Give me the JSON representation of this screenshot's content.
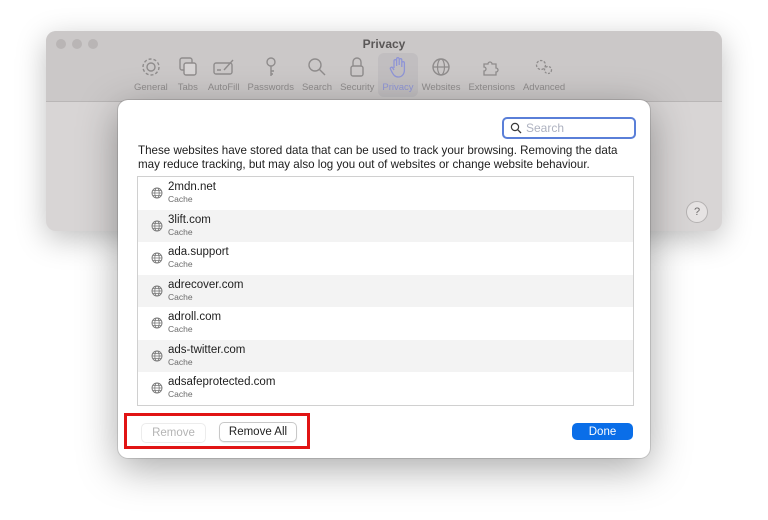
{
  "prefs": {
    "title": "Privacy",
    "toolbar": [
      {
        "label": "General",
        "icon": "gear-icon"
      },
      {
        "label": "Tabs",
        "icon": "tabs-icon"
      },
      {
        "label": "AutoFill",
        "icon": "autofill-icon"
      },
      {
        "label": "Passwords",
        "icon": "key-icon"
      },
      {
        "label": "Search",
        "icon": "search-icon"
      },
      {
        "label": "Security",
        "icon": "lock-icon"
      },
      {
        "label": "Privacy",
        "icon": "hand-icon",
        "active": true
      },
      {
        "label": "Websites",
        "icon": "globe-icon"
      },
      {
        "label": "Extensions",
        "icon": "puzzle-icon"
      },
      {
        "label": "Advanced",
        "icon": "gears-icon"
      }
    ],
    "help": "?"
  },
  "sheet": {
    "search_placeholder": "Search",
    "description": "These websites have stored data that can be used to track your browsing. Removing the data may reduce tracking, but may also log you out of websites or change website behaviour.",
    "sites": [
      {
        "domain": "2mdn.net",
        "type": "Cache"
      },
      {
        "domain": "3lift.com",
        "type": "Cache"
      },
      {
        "domain": "ada.support",
        "type": "Cache"
      },
      {
        "domain": "adrecover.com",
        "type": "Cache"
      },
      {
        "domain": "adroll.com",
        "type": "Cache"
      },
      {
        "domain": "ads-twitter.com",
        "type": "Cache"
      },
      {
        "domain": "adsafeprotected.com",
        "type": "Cache"
      }
    ],
    "buttons": {
      "remove": "Remove",
      "remove_all": "Remove All",
      "done": "Done"
    }
  },
  "colors": {
    "accent": "#0a6ee8",
    "highlight": "#e11414",
    "active_tab": "#8f95d6"
  }
}
